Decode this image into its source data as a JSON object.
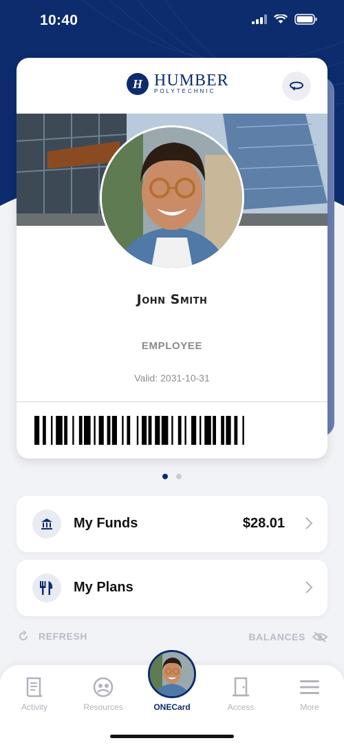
{
  "status_bar": {
    "time": "10:40"
  },
  "card": {
    "logo_name": "HUMBER",
    "logo_sub": "POLYTECHNIC",
    "name": "John Smith",
    "role": "EMPLOYEE",
    "valid": "Valid: 2031-10-31"
  },
  "pager": {
    "count": 2,
    "active": 1
  },
  "funds": {
    "label": "My Funds",
    "amount": "$28.01",
    "icon": "bank-icon"
  },
  "plans": {
    "label": "My Plans",
    "icon": "fork-knife-icon"
  },
  "refresh_label": "REFRESH",
  "balances_label": "BALANCES",
  "tabs": [
    {
      "label": "Activity",
      "icon": "receipt-icon"
    },
    {
      "label": "Resources",
      "icon": "resources-icon"
    },
    {
      "label": "ONECard",
      "icon": "avatar"
    },
    {
      "label": "Access",
      "icon": "door-icon"
    },
    {
      "label": "More",
      "icon": "menu-icon"
    }
  ],
  "colors": {
    "brand": "#0d2c6e",
    "background": "#f2f3f7",
    "muted": "#b9bcc5"
  }
}
